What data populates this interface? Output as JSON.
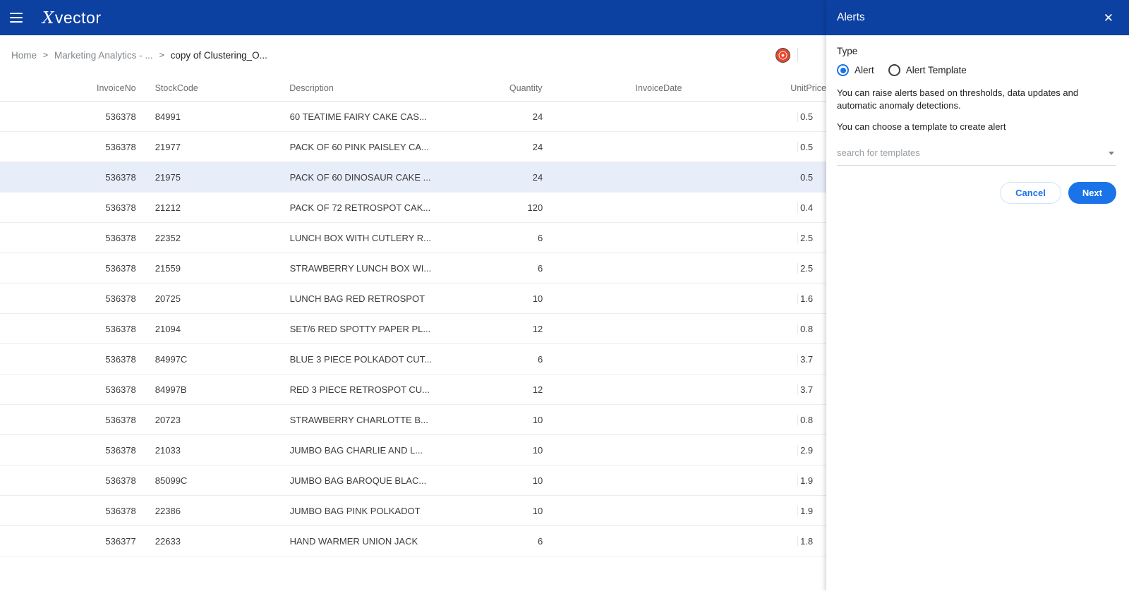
{
  "app": {
    "logo_x": "X",
    "logo_rest": "vector"
  },
  "breadcrumb": {
    "separator": ">",
    "items": [
      {
        "label": "Home"
      },
      {
        "label": "Marketing Analytics - ..."
      },
      {
        "label": "copy of Clustering_O..."
      }
    ]
  },
  "table": {
    "columns": {
      "invoice_no": "InvoiceNo",
      "stock_code": "StockCode",
      "description": "Description",
      "quantity": "Quantity",
      "invoice_date": "InvoiceDate",
      "unit_price": "UnitPrice"
    },
    "selected_row_index": 2,
    "rows": [
      {
        "invoice_no": "536378",
        "stock_code": "84991",
        "description": "60 TEATIME FAIRY CAKE CAS...",
        "quantity": "24",
        "invoice_date": "",
        "unit_price": "0.5"
      },
      {
        "invoice_no": "536378",
        "stock_code": "21977",
        "description": "PACK OF 60 PINK PAISLEY CA...",
        "quantity": "24",
        "invoice_date": "",
        "unit_price": "0.5"
      },
      {
        "invoice_no": "536378",
        "stock_code": "21975",
        "description": "PACK OF 60 DINOSAUR CAKE ...",
        "quantity": "24",
        "invoice_date": "",
        "unit_price": "0.5"
      },
      {
        "invoice_no": "536378",
        "stock_code": "21212",
        "description": "PACK OF 72 RETROSPOT CAK...",
        "quantity": "120",
        "invoice_date": "",
        "unit_price": "0.4"
      },
      {
        "invoice_no": "536378",
        "stock_code": "22352",
        "description": "LUNCH BOX WITH CUTLERY R...",
        "quantity": "6",
        "invoice_date": "",
        "unit_price": "2.5"
      },
      {
        "invoice_no": "536378",
        "stock_code": "21559",
        "description": "STRAWBERRY LUNCH BOX WI...",
        "quantity": "6",
        "invoice_date": "",
        "unit_price": "2.5"
      },
      {
        "invoice_no": "536378",
        "stock_code": "20725",
        "description": "LUNCH BAG RED RETROSPOT",
        "quantity": "10",
        "invoice_date": "",
        "unit_price": "1.6"
      },
      {
        "invoice_no": "536378",
        "stock_code": "21094",
        "description": "SET/6 RED SPOTTY PAPER PL...",
        "quantity": "12",
        "invoice_date": "",
        "unit_price": "0.8"
      },
      {
        "invoice_no": "536378",
        "stock_code": "84997C",
        "description": "BLUE 3 PIECE POLKADOT CUT...",
        "quantity": "6",
        "invoice_date": "",
        "unit_price": "3.7"
      },
      {
        "invoice_no": "536378",
        "stock_code": "84997B",
        "description": "RED 3 PIECE RETROSPOT CU...",
        "quantity": "12",
        "invoice_date": "",
        "unit_price": "3.7"
      },
      {
        "invoice_no": "536378",
        "stock_code": "20723",
        "description": "STRAWBERRY CHARLOTTE B...",
        "quantity": "10",
        "invoice_date": "",
        "unit_price": "0.8"
      },
      {
        "invoice_no": "536378",
        "stock_code": "21033",
        "description": "JUMBO BAG CHARLIE AND L...",
        "quantity": "10",
        "invoice_date": "",
        "unit_price": "2.9"
      },
      {
        "invoice_no": "536378",
        "stock_code": "85099C",
        "description": "JUMBO BAG BAROQUE BLAC...",
        "quantity": "10",
        "invoice_date": "",
        "unit_price": "1.9"
      },
      {
        "invoice_no": "536378",
        "stock_code": "22386",
        "description": "JUMBO BAG PINK POLKADOT",
        "quantity": "10",
        "invoice_date": "",
        "unit_price": "1.9"
      },
      {
        "invoice_no": "536377",
        "stock_code": "22633",
        "description": "HAND WARMER UNION JACK",
        "quantity": "6",
        "invoice_date": "",
        "unit_price": "1.8"
      }
    ]
  },
  "panel": {
    "title": "Alerts",
    "close_glyph": "✕",
    "type_label": "Type",
    "radio_options": [
      {
        "label": "Alert",
        "selected": true
      },
      {
        "label": "Alert Template",
        "selected": false
      }
    ],
    "description": "You can raise alerts based on thresholds, data updates and automatic anomaly detections.",
    "hint": "You can choose a template to create alert",
    "search_placeholder": "search for templates",
    "cancel_label": "Cancel",
    "next_label": "Next"
  },
  "colors": {
    "header_blue": "#0c41a2",
    "accent_blue": "#1a73e8",
    "selected_row_bg": "#e7edf9"
  }
}
